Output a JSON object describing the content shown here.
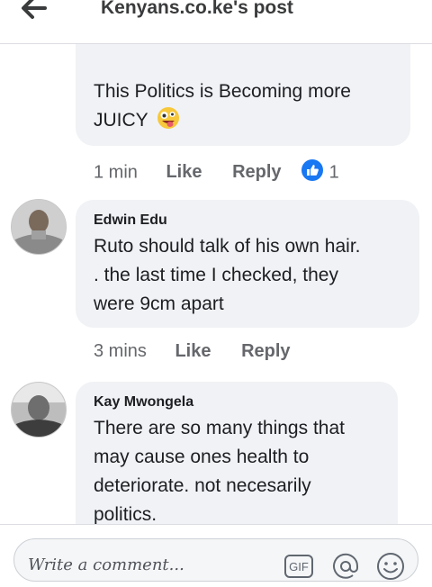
{
  "header": {
    "title": "Kenyans.co.ke's post",
    "back_icon": "arrow-left-icon"
  },
  "comments": [
    {
      "text_lines": [
        "This Politics is Becoming more",
        "JUICY"
      ],
      "trailing_emoji": "zany-face-emoji",
      "time": "1 min",
      "like_label": "Like",
      "reply_label": "Reply",
      "reaction_count": "1",
      "reaction_icon": "thumbs-up-icon"
    },
    {
      "author": "Edwin Edu",
      "text_lines": [
        "Ruto should talk of his own hair.",
        ". the last time I checked, they",
        "were 9cm apart"
      ],
      "time": "3 mins",
      "like_label": "Like",
      "reply_label": "Reply"
    },
    {
      "author": "Kay Mwongela",
      "text_lines": [
        "There are so many things that",
        "may cause ones health to",
        "deteriorate. not necesarily",
        "politics."
      ]
    }
  ],
  "composer": {
    "placeholder": "Write a comment...",
    "gif_label": "GIF",
    "icons": [
      "gif-icon",
      "at-icon",
      "smiley-icon"
    ]
  },
  "colors": {
    "accent": "#1877f2",
    "bubble": "#f0f2f5",
    "meta": "#65676b"
  }
}
